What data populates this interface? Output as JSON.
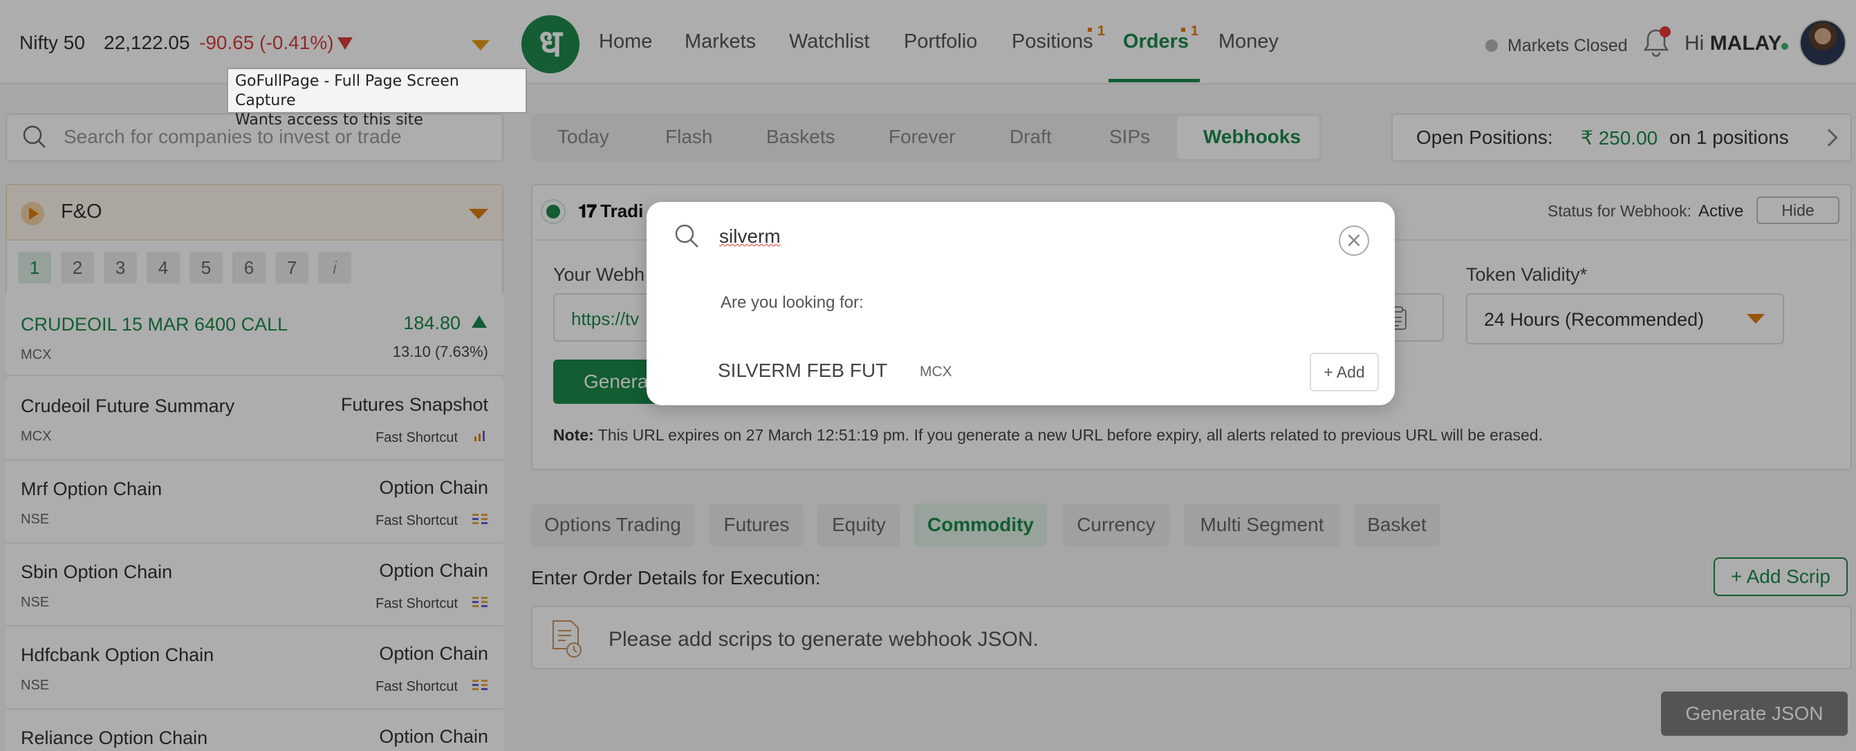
{
  "index": {
    "name": "Nifty 50",
    "value": "22,122.05",
    "change": "-90.65 (-0.41%)"
  },
  "tooltip": {
    "line1": "GoFullPage - Full Page Screen Capture",
    "line2": "Wants access to this site"
  },
  "logo_glyph": "ध",
  "nav": {
    "home": "Home",
    "markets": "Markets",
    "watchlist": "Watchlist",
    "portfolio": "Portfolio",
    "positions": "Positions",
    "positions_badge": "1",
    "orders": "Orders",
    "orders_badge": "1",
    "money": "Money"
  },
  "market_status": "Markets Closed",
  "user": {
    "greeting": "Hi",
    "name": "MALAY"
  },
  "search": {
    "placeholder": "Search for companies to invest or trade"
  },
  "order_tabs": [
    "Today",
    "Flash",
    "Baskets",
    "Forever",
    "Draft",
    "SIPs",
    "Webhooks"
  ],
  "open_positions": {
    "label": "Open Positions:",
    "value": "₹ 250.00",
    "suffix": "on 1 positions"
  },
  "watchlist_group": "F&O",
  "pages": [
    "1",
    "2",
    "3",
    "4",
    "5",
    "6",
    "7",
    "i"
  ],
  "watchlist": [
    {
      "title": "CRUDEOIL 15 MAR 6400 CALL",
      "exchange": "MCX",
      "price": "184.80",
      "change": "13.10 (7.63%)"
    },
    {
      "title": "Crudeoil Future Summary",
      "exchange": "MCX",
      "right": "Futures Snapshot",
      "shortcut": "Fast Shortcut"
    },
    {
      "title": "Mrf Option Chain",
      "exchange": "NSE",
      "right": "Option Chain",
      "shortcut": "Fast Shortcut"
    },
    {
      "title": "Sbin Option Chain",
      "exchange": "NSE",
      "right": "Option Chain",
      "shortcut": "Fast Shortcut"
    },
    {
      "title": "Hdfcbank Option Chain",
      "exchange": "NSE",
      "right": "Option Chain",
      "shortcut": "Fast Shortcut"
    },
    {
      "title": "Reliance Option Chain",
      "right": "Option Chain"
    }
  ],
  "webhook": {
    "brand": "Tradi",
    "status_label": "Status for Webhook:",
    "status_value": "Active",
    "hide_label": "Hide",
    "url_label": "Your Webh",
    "url_value": "https://tv",
    "token_label": "Token Validity*",
    "token_value": "24 Hours (Recommended)",
    "generate_label": "Genera",
    "note_label": "Note:",
    "note_text": "This URL expires on 27 March 12:51:19 pm. If you generate a new URL before expiry, all alerts related to previous URL will be erased."
  },
  "segments": [
    "Options Trading",
    "Futures",
    "Equity",
    "Commodity",
    "Currency",
    "Multi Segment",
    "Basket"
  ],
  "exec_label": "Enter Order Details for Execution:",
  "add_scrip_label": "+ Add Scrip",
  "empty_text": "Please add scrips to generate webhook JSON.",
  "generate_json_label": "Generate JSON",
  "modal": {
    "query": "silverm",
    "hint": "Are you looking for:",
    "result_name": "SILVERM FEB FUT",
    "result_exchange": "MCX",
    "add_label": "+ Add"
  },
  "colors": {
    "brand_green": "#1b8a4a",
    "negative_red": "#d43f3a",
    "accent_orange": "#e07c0b"
  }
}
